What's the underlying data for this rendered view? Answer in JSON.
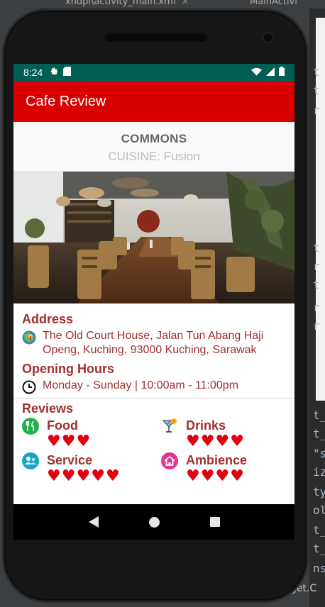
{
  "ide": {
    "tab1": "xhdpi\\activity_main.xml",
    "tab2": "MainActivi",
    "close": "×",
    "right_letters": [
      "t",
      "t",
      "r",
      "t",
      "r",
      "t",
      "r",
      "r"
    ],
    "bottom_lines": [
      "t_",
      "t_",
      "\"s",
      "iz",
      "ty",
      "ol",
      "t_",
      "t_",
      "ns"
    ],
    "bottom_text": "uget.C"
  },
  "status_bar": {
    "time": "8:24",
    "gear_icon": "gear-icon",
    "sd_icon": "sd-card-icon",
    "wifi_icon": "wifi-icon",
    "signal_icon": "signal-icon",
    "battery_icon": "battery-icon"
  },
  "app_bar": {
    "title": "Cafe Review"
  },
  "cafe": {
    "name": "COMMONS",
    "cuisine": "CUISINE: Fusion"
  },
  "address": {
    "title": "Address",
    "icon": "map-icon",
    "text": "The Old Court House, Jalan Tun Abang Haji Openg, Kuching, 93000 Kuching, Sarawak"
  },
  "hours": {
    "title": "Opening Hours",
    "icon": "clock-icon",
    "text": "Monday - Sunday | 10:00am - 11:00pm"
  },
  "reviews": {
    "title": "Reviews",
    "items": [
      {
        "label": "Food",
        "icon": "fork-knife-icon",
        "rating": 3,
        "color": "#1db34a"
      },
      {
        "label": "Drinks",
        "icon": "cocktail-icon",
        "rating": 4,
        "color": "#e6a300"
      },
      {
        "label": "Service",
        "icon": "service-icon",
        "rating": 5,
        "color": "#1aa3c7"
      },
      {
        "label": "Ambience",
        "icon": "home-icon",
        "rating": 4,
        "color": "#e3348f"
      }
    ]
  },
  "colors": {
    "status_bar": "#005e54",
    "app_bar": "#d80000",
    "accent_text": "#a1302f",
    "heart": "#e00010"
  }
}
